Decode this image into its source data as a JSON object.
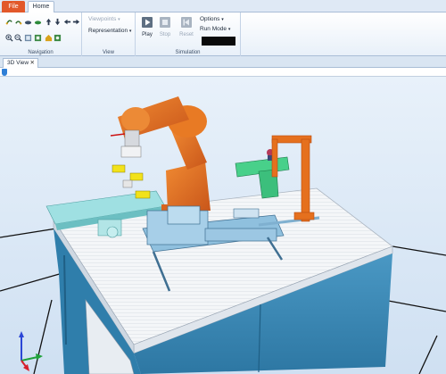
{
  "menu": {
    "file_label": "File",
    "home_label": "Home"
  },
  "ribbon": {
    "navigation": {
      "label": "Navigation"
    },
    "view": {
      "label": "View",
      "viewpoints_label": "Viewpoints",
      "representation_label": "Representation"
    },
    "simulation": {
      "label": "Simulation",
      "play_label": "Play",
      "stop_label": "Stop",
      "reset_label": "Reset",
      "options_label": "Options",
      "run_mode_label": "Run Mode"
    }
  },
  "document": {
    "tab_label": "3D View",
    "close_glyph": "✕"
  },
  "colors": {
    "file_tab": "#e2582a",
    "robot": "#e5701e",
    "table_top": "#f4f6f8",
    "cabinet": "#3a88b5",
    "fixture_blue": "#8fc0de",
    "conveyor_cyan": "#9fe0e2",
    "gripper_green": "#48d08a",
    "part_yellow": "#f2e21a"
  },
  "icons": [
    "zoom-in-icon",
    "zoom-out-icon",
    "arrow-up-icon",
    "arrow-down-icon",
    "arrow-left-icon",
    "arrow-right-icon",
    "play-icon",
    "stop-icon",
    "reset-icon"
  ]
}
